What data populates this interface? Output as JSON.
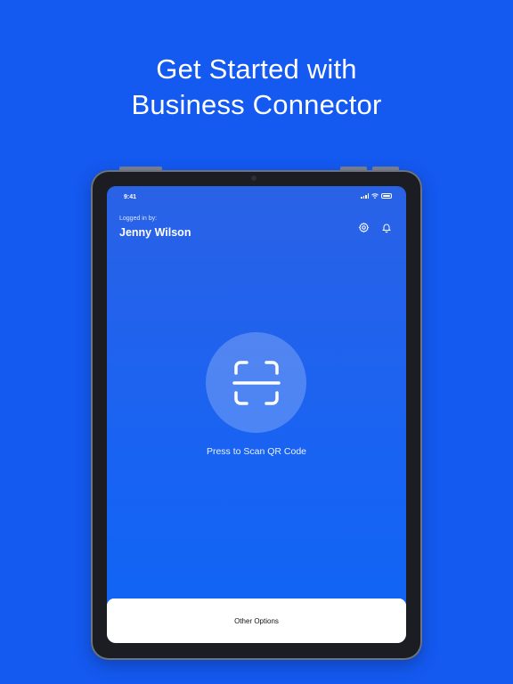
{
  "headline": {
    "line1": "Get Started with",
    "line2": "Business Connector"
  },
  "status_bar": {
    "time": "9:41"
  },
  "header": {
    "logged_in_label": "Logged in by:",
    "user_name": "Jenny Wilson"
  },
  "icons": {
    "settings": "gear-icon",
    "notifications": "bell-icon",
    "scan": "qr-scan-icon"
  },
  "scan": {
    "label": "Press to Scan QR Code"
  },
  "bottom_sheet": {
    "label": "Other Options"
  },
  "colors": {
    "background": "#1459f0",
    "screen_top": "#2a62e6",
    "screen_bottom": "#0f64f6",
    "device_frame": "#1b1d22",
    "sheet": "#ffffff"
  }
}
